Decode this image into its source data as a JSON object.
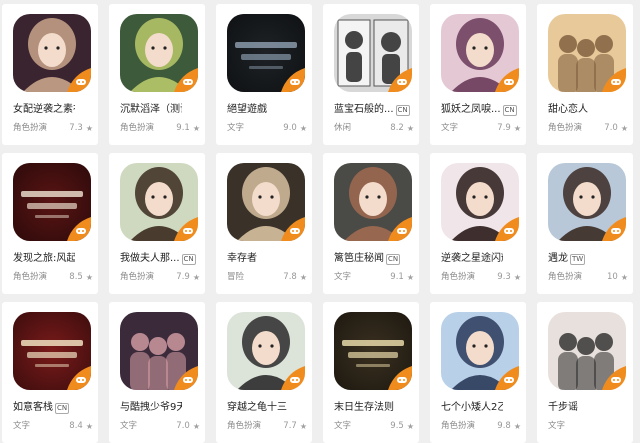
{
  "games": [
    {
      "name": "女配逆袭之素衣",
      "tag": "",
      "category": "角色扮演",
      "score": "7.3",
      "icon": "portrait-icon",
      "bg": "#3a2430",
      "accent": "#c9a48b"
    },
    {
      "name": "沉默滔泽（测试...",
      "tag": "",
      "category": "角色扮演",
      "score": "9.1",
      "icon": "portrait-icon",
      "bg": "#3d5a3a",
      "accent": "#b8c96a"
    },
    {
      "name": "絕望遊戲",
      "tag": "",
      "category": "文字",
      "score": "9.0",
      "icon": "title-art-icon",
      "bg": "#1e2226",
      "accent": "#8899aa"
    },
    {
      "name": "蓝宝石般的...",
      "tag": "CN",
      "category": "休闲",
      "score": "8.2",
      "icon": "manga-icon",
      "bg": "#d8d8d8",
      "accent": "#444444"
    },
    {
      "name": "狐妖之凤唳...",
      "tag": "CN",
      "category": "文字",
      "score": "7.9",
      "icon": "portrait-icon",
      "bg": "#e4c9d4",
      "accent": "#6a3a5a"
    },
    {
      "name": "甜心恋人",
      "tag": "",
      "category": "角色扮演",
      "score": "7.0",
      "icon": "group-icon",
      "bg": "#e8c99a",
      "accent": "#7a5a3a"
    },
    {
      "name": "发现之旅:风起...",
      "tag": "",
      "category": "角色扮演",
      "score": "8.5",
      "icon": "title-art-icon",
      "bg": "#5a1414",
      "accent": "#e8d8c8"
    },
    {
      "name": "我做夫人那...",
      "tag": "CN",
      "category": "角色扮演",
      "score": "7.9",
      "icon": "portrait-icon",
      "bg": "#cfd9c0",
      "accent": "#3a2a1e"
    },
    {
      "name": "幸存者",
      "tag": "",
      "category": "冒险",
      "score": "7.8",
      "icon": "portrait-icon",
      "bg": "#3a3228",
      "accent": "#d8c0a0"
    },
    {
      "name": "篱笆庄秘闻",
      "tag": "CN",
      "category": "文字",
      "score": "9.1",
      "icon": "portrait-icon",
      "bg": "#4a4a46",
      "accent": "#a06a50"
    },
    {
      "name": "逆袭之星途闪耀...",
      "tag": "",
      "category": "角色扮演",
      "score": "9.3",
      "icon": "portrait-icon",
      "bg": "#f0e6ea",
      "accent": "#2a1a1a"
    },
    {
      "name": "遇龙",
      "tag": "TW",
      "category": "角色扮演",
      "score": "10",
      "icon": "portrait-icon",
      "bg": "#b8c8d8",
      "accent": "#3a2a24"
    },
    {
      "name": "如意客栈",
      "tag": "CN",
      "category": "文字",
      "score": "8.4",
      "icon": "title-art-icon",
      "bg": "#7a1a1a",
      "accent": "#f0e0c0"
    },
    {
      "name": "与酷拽少爷9天...",
      "tag": "",
      "category": "文字",
      "score": "7.0",
      "icon": "group-icon",
      "bg": "#3a2a3a",
      "accent": "#d8a0a8"
    },
    {
      "name": "穿越之龟十三",
      "tag": "",
      "category": "角色扮演",
      "score": "7.7",
      "icon": "portrait-icon",
      "bg": "#dce4da",
      "accent": "#2a2a2a"
    },
    {
      "name": "末日生存法则",
      "tag": "",
      "category": "文字",
      "score": "9.5",
      "icon": "title-art-icon",
      "bg": "#3a3020",
      "accent": "#e8d8a8"
    },
    {
      "name": "七个小矮人2乙...",
      "tag": "",
      "category": "角色扮演",
      "score": "9.8",
      "icon": "portrait-icon",
      "bg": "#b8d0e8",
      "accent": "#2a3a5a"
    },
    {
      "name": "千步谣",
      "tag": "",
      "category": "文字",
      "score": "",
      "icon": "group-icon",
      "bg": "#e8e0dc",
      "accent": "#2a2a2a"
    }
  ],
  "ui": {
    "star": "★",
    "badge_color": "#f08c1e"
  }
}
